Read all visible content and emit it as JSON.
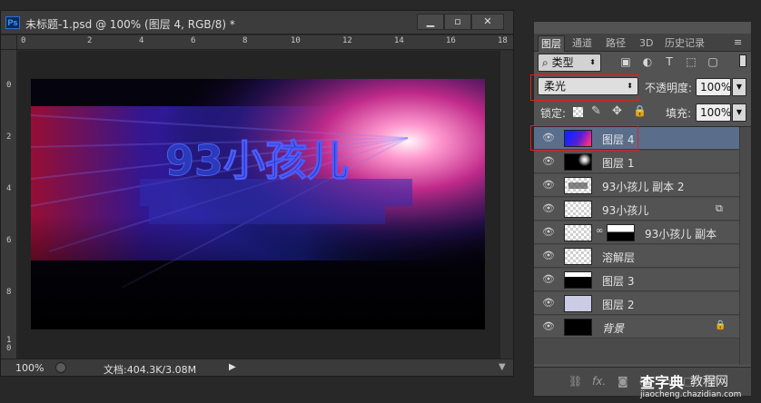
{
  "document": {
    "app_icon": "Ps",
    "title": "未标题-1.psd @ 100% (图层 4, RGB/8) *",
    "window_buttons": [
      "minimize-icon",
      "restore-icon",
      "close-icon"
    ],
    "ruler_h": [
      "0",
      "2",
      "4",
      "6",
      "8",
      "10",
      "12",
      "14",
      "16",
      "18"
    ],
    "ruler_v": [
      "0",
      "2",
      "4",
      "6",
      "8",
      "1\n0"
    ],
    "canvas_text": "93小孩儿",
    "zoom": "100%",
    "doc_info": "文档:404.3K/3.08M"
  },
  "layers_panel": {
    "tabs": [
      "图层",
      "通道",
      "路径",
      "3D",
      "历史记录"
    ],
    "active_tab": 0,
    "filter_kind": "类型",
    "blend_mode": "柔光",
    "opacity_label": "不透明度:",
    "opacity_value": "100%",
    "lock_label": "锁定:",
    "fill_label": "填充:",
    "fill_value": "100%",
    "layers": [
      {
        "name": "图层 4",
        "selected": true
      },
      {
        "name": "图层 1",
        "selected": false
      },
      {
        "name": "93小孩儿 副本 2",
        "selected": false
      },
      {
        "name": "93小孩儿",
        "selected": false
      },
      {
        "name": "93小孩儿 副本",
        "selected": false
      },
      {
        "name": "溶解层",
        "selected": false
      },
      {
        "name": "图层 3",
        "selected": false
      },
      {
        "name": "图层 2",
        "selected": false
      },
      {
        "name": "背景",
        "selected": false
      }
    ]
  },
  "watermark": {
    "brand": "查字典",
    "brand2": "教程网",
    "url": "jiaocheng.chazidian.com"
  },
  "colors": {
    "highlight_box": "#e02020",
    "selected_row": "#5a6e8c",
    "canvas_blue": "#2a3cff",
    "canvas_pink": "#ff4aa8"
  }
}
